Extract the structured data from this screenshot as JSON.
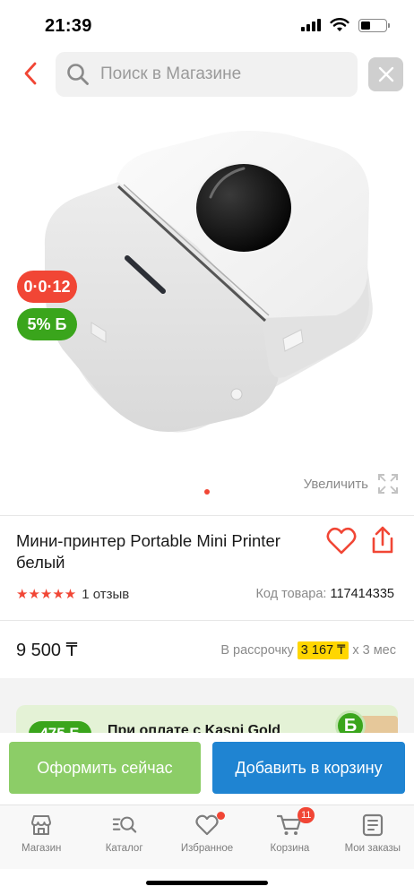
{
  "status_bar": {
    "time": "21:39"
  },
  "search": {
    "placeholder": "Поиск в Магазине"
  },
  "promo_badges": {
    "installment": "0·0·12",
    "bonus": "5% Б"
  },
  "gallery": {
    "zoom_label": "Увеличить",
    "current_slide": 1,
    "slide_count": 1
  },
  "product": {
    "title": "Мини-принтер Portable Mini Printer белый",
    "rating": 5,
    "stars": "★★★★★",
    "reviews": "1 отзыв",
    "code_label": "Код товара:",
    "code": "117414335",
    "price": "9 500 ₸",
    "installment_prefix": "В рассрочку",
    "installment_amount": "3 167 ₸",
    "installment_suffix": "х 3 мес"
  },
  "kaspi_promo": {
    "bonus": "475 Б",
    "text": "При оплате с Kaspi Gold",
    "coin_symbol": "Б"
  },
  "actions": {
    "buy_now": "Оформить сейчас",
    "add_to_cart": "Добавить в корзину"
  },
  "tabs": [
    {
      "label": "Магазин",
      "icon": "store-icon"
    },
    {
      "label": "Каталог",
      "icon": "catalog-icon"
    },
    {
      "label": "Избранное",
      "icon": "heart-icon"
    },
    {
      "label": "Корзина",
      "icon": "cart-icon",
      "badge": "11"
    },
    {
      "label": "Мои заказы",
      "icon": "orders-icon"
    }
  ],
  "colors": {
    "accent_red": "#f14635",
    "green": "#3aa51c",
    "buy_button": "#8ccd67",
    "cart_button": "#1f84d2",
    "installment_highlight": "#ffd600"
  }
}
